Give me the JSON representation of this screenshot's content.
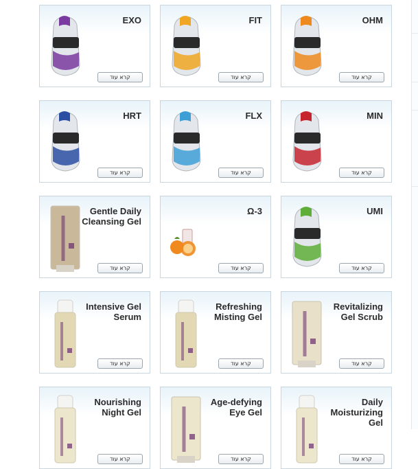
{
  "read_more_label": "קרא עוד",
  "products": [
    {
      "title": "EXO",
      "image": "sachet",
      "color": "#7a3aa0"
    },
    {
      "title": "FIT",
      "image": "sachet",
      "color": "#f0a623"
    },
    {
      "title": "OHM",
      "image": "sachet",
      "color": "#ee8a1d"
    },
    {
      "title": "HRT",
      "image": "sachet",
      "color": "#2b4fa3"
    },
    {
      "title": "FLX",
      "image": "sachet",
      "color": "#3e9fd6"
    },
    {
      "title": "MIN",
      "image": "sachet",
      "color": "#c62530"
    },
    {
      "title": "Gentle Daily Cleansing Gel",
      "image": "ageless-tube",
      "color": "#c9b99a"
    },
    {
      "title": "Ω-3",
      "image": "omega-orange",
      "color": "#f08a1e"
    },
    {
      "title": "UMI",
      "image": "sachet",
      "color": "#5fae3a"
    },
    {
      "title": "Intensive Gel Serum",
      "image": "ageless-pump",
      "color": "#e2d9b4"
    },
    {
      "title": "Refreshing Misting Gel",
      "image": "ageless-pump",
      "color": "#e2d9b4"
    },
    {
      "title": "Revitalizing Gel Scrub",
      "image": "ageless-tube",
      "color": "#e8e0c8"
    },
    {
      "title": "Nourishing Night Gel",
      "image": "ageless-pump",
      "color": "#ece6cc"
    },
    {
      "title": "Age-defying Eye Gel",
      "image": "ageless-tube",
      "color": "#ece6cc"
    },
    {
      "title": "Daily Moisturizing Gel",
      "image": "ageless-pump",
      "color": "#ece6cc"
    }
  ]
}
